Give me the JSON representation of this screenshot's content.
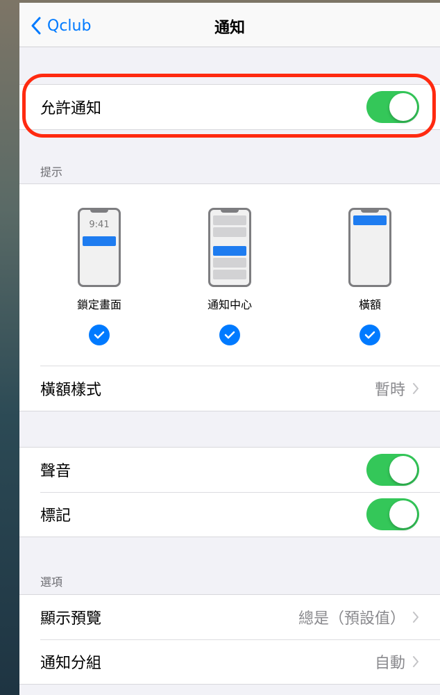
{
  "nav": {
    "back_label": "Qclub",
    "title": "通知"
  },
  "allow": {
    "label": "允許通知",
    "on": true
  },
  "alerts": {
    "header": "提示",
    "options": [
      {
        "label": "鎖定畫面",
        "checked": true,
        "preview_time": "9:41"
      },
      {
        "label": "通知中心",
        "checked": true
      },
      {
        "label": "橫額",
        "checked": true
      }
    ],
    "banner_style": {
      "label": "橫額樣式",
      "value": "暫時"
    }
  },
  "sound": {
    "label": "聲音",
    "on": true
  },
  "badges": {
    "label": "標記",
    "on": true
  },
  "options": {
    "header": "選項",
    "show_previews": {
      "label": "顯示預覽",
      "value": "總是（預設值）"
    },
    "grouping": {
      "label": "通知分組",
      "value": "自動"
    }
  },
  "colors": {
    "accent": "#007aff",
    "toggle_on": "#34c759",
    "highlight": "#ff2a10"
  }
}
